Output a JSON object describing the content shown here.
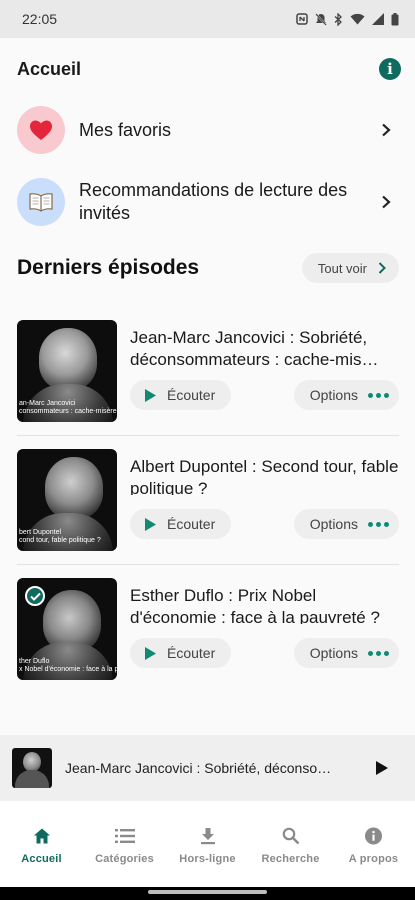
{
  "status_bar": {
    "time": "22:05"
  },
  "header": {
    "title": "Accueil"
  },
  "nav_rows": [
    {
      "label": "Mes favoris",
      "icon": "heart-icon",
      "circle_color": "#f8c9cf"
    },
    {
      "label": "Recommandations de lecture des invités",
      "icon": "book-icon",
      "circle_color": "#c9defa"
    }
  ],
  "latest": {
    "title": "Derniers épisodes",
    "see_all": "Tout voir"
  },
  "episodes": [
    {
      "title": "Jean-Marc Jancovici : Sobriété, déconsommateurs : cache-mis…",
      "thumb_caption": "an-Marc Jancovici\nconsommateurs : cache-misère du gr",
      "listen": "Écouter",
      "options": "Options",
      "listened": false
    },
    {
      "title": "Albert Dupontel : Second tour, fable politique ?",
      "thumb_caption": "bert Dupontel\ncond tour, fable politique ?",
      "listen": "Écouter",
      "options": "Options",
      "listened": false
    },
    {
      "title": "Esther Duflo : Prix Nobel d'économie : face à la pauvreté ?",
      "thumb_caption": "ther Duflo\nx Nobel d'économie : face à la pau",
      "listen": "Écouter",
      "options": "Options",
      "listened": true
    }
  ],
  "mini_player": {
    "title": "Jean-Marc Jancovici : Sobriété, déconso…"
  },
  "bottom_nav": [
    {
      "label": "Accueil",
      "icon": "home-icon",
      "active": true
    },
    {
      "label": "Catégories",
      "icon": "list-icon",
      "active": false
    },
    {
      "label": "Hors-ligne",
      "icon": "download-icon",
      "active": false
    },
    {
      "label": "Recherche",
      "icon": "search-icon",
      "active": false
    },
    {
      "label": "A propos",
      "icon": "info-icon",
      "active": false
    }
  ],
  "colors": {
    "accent": "#0f6b5f",
    "accent_light": "#0f8a72"
  }
}
